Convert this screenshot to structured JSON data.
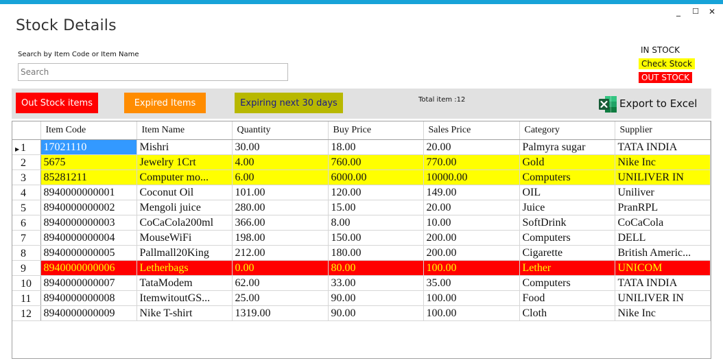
{
  "window": {
    "title": "Stock Details",
    "minimize_glyph": "_",
    "maximize_glyph": "☐",
    "close_glyph": "✕"
  },
  "search": {
    "label": "Search by Item Code or Item Name",
    "placeholder": "Search",
    "value": ""
  },
  "legend": {
    "in_stock": "IN STOCK",
    "check_stock": "Check Stock",
    "out_stock": "OUT STOCK"
  },
  "toolbar": {
    "out_stock_label": "Out Stock items",
    "expired_label": "Expired Items",
    "expiring_label": "Expiring next 30 days",
    "total_text": "Total item :12",
    "export_label": "Export to Excel",
    "export_icon": "excel-icon"
  },
  "colors": {
    "accent_bar": "#17a3d8",
    "check_stock": "#ffff00",
    "out_stock": "#ff0000",
    "selected": "#3399ff",
    "expired_button": "#ff8c00",
    "expiring_button": "#b8b800"
  },
  "table": {
    "columns": [
      "Item Code",
      "Item Name",
      "Quantity",
      "Buy Price",
      "Sales Price",
      "Category",
      "Supplier"
    ],
    "rows": [
      {
        "num": "1",
        "status": "in",
        "cells": [
          "17021110",
          "Mishri",
          "30.00",
          "18.00",
          "20.00",
          "Palmyra  sugar",
          "TATA INDIA"
        ]
      },
      {
        "num": "2",
        "status": "check",
        "cells": [
          "5675",
          "Jewelry  1Crt",
          "4.00",
          "760.00",
          "770.00",
          "Gold",
          "Nike Inc"
        ]
      },
      {
        "num": "3",
        "status": "check",
        "cells": [
          "85281211",
          "Computer mo...",
          "6.00",
          "6000.00",
          "10000.00",
          "Computers",
          "UNILIVER IN"
        ]
      },
      {
        "num": "4",
        "status": "in",
        "cells": [
          "8940000000001",
          "Coconut Oil",
          "101.00",
          "120.00",
          "149.00",
          "OIL",
          "Uniliver"
        ]
      },
      {
        "num": "5",
        "status": "in",
        "cells": [
          "8940000000002",
          "Mengoli  juice",
          "280.00",
          "15.00",
          "20.00",
          "Juice",
          "PranRPL"
        ]
      },
      {
        "num": "6",
        "status": "in",
        "cells": [
          "8940000000003",
          "CoCaCola200ml",
          "366.00",
          "8.00",
          "10.00",
          "SoftDrink",
          "CoCaCola"
        ]
      },
      {
        "num": "7",
        "status": "in",
        "cells": [
          "8940000000004",
          "MouseWiFi",
          "198.00",
          "150.00",
          "200.00",
          "Computers",
          "DELL"
        ]
      },
      {
        "num": "8",
        "status": "in",
        "cells": [
          "8940000000005",
          "Pallmall20King",
          "212.00",
          "180.00",
          "200.00",
          "Cigarette",
          "British Americ..."
        ]
      },
      {
        "num": "9",
        "status": "out",
        "cells": [
          "8940000000006",
          "Letherbags",
          "0.00",
          "80.00",
          "100.00",
          "Lether",
          "UNICOM"
        ]
      },
      {
        "num": "10",
        "status": "in",
        "cells": [
          "8940000000007",
          "TataModem",
          "62.00",
          "33.00",
          "35.00",
          "Computers",
          "TATA INDIA"
        ]
      },
      {
        "num": "11",
        "status": "in",
        "cells": [
          "8940000000008",
          "ItemwitoutGS...",
          "25.00",
          "90.00",
          "100.00",
          "Food",
          "UNILIVER IN"
        ]
      },
      {
        "num": "12",
        "status": "in",
        "cells": [
          "8940000000009",
          "Nike T-shirt",
          "1319.00",
          "90.00",
          "100.00",
          "Cloth",
          "Nike Inc"
        ]
      }
    ]
  }
}
